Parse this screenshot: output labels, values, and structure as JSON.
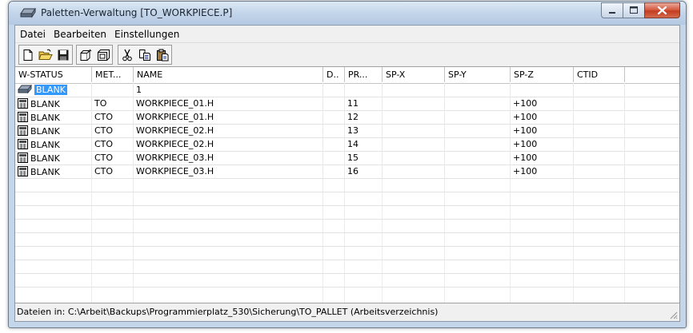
{
  "window": {
    "title": "Paletten-Verwaltung [TO_WORKPIECE.P]",
    "controls": [
      "minimize-icon",
      "maximize-icon",
      "close-icon"
    ],
    "accent_colors": {
      "titlebar": "#c3d5ea",
      "close_button": "#c43c1f",
      "selection": "#3399ff"
    }
  },
  "menu": {
    "file": "Datei",
    "edit": "Bearbeiten",
    "settings": "Einstellungen"
  },
  "toolbar": {
    "buttons": [
      "new-file-icon",
      "open-folder-icon",
      "save-icon",
      "clamp-icon",
      "frame-icon",
      "cut-icon",
      "copy-icon",
      "paste-icon"
    ]
  },
  "table": {
    "columns": [
      "W-STATUS",
      "MET...",
      "NAME",
      "D..",
      "PR...",
      "SP-X",
      "SP-Y",
      "SP-Z",
      "CTID"
    ],
    "rows": [
      {
        "status": "BLANK",
        "method": "",
        "name": "1",
        "d": "",
        "pr": "",
        "spx": "",
        "spy": "",
        "spz": "",
        "ctid": "",
        "icon": "pallet-icon",
        "selected": true
      },
      {
        "status": "BLANK",
        "method": "TO",
        "name": "WORKPIECE_01.H",
        "d": "",
        "pr": "11",
        "spx": "",
        "spy": "",
        "spz": "+100",
        "ctid": "",
        "icon": "workpiece-icon"
      },
      {
        "status": "BLANK",
        "method": "CTO",
        "name": "WORKPIECE_01.H",
        "d": "",
        "pr": "12",
        "spx": "",
        "spy": "",
        "spz": "+100",
        "ctid": "",
        "icon": "workpiece-icon"
      },
      {
        "status": "BLANK",
        "method": "CTO",
        "name": "WORKPIECE_02.H",
        "d": "",
        "pr": "13",
        "spx": "",
        "spy": "",
        "spz": "+100",
        "ctid": "",
        "icon": "workpiece-icon"
      },
      {
        "status": "BLANK",
        "method": "CTO",
        "name": "WORKPIECE_02.H",
        "d": "",
        "pr": "14",
        "spx": "",
        "spy": "",
        "spz": "+100",
        "ctid": "",
        "icon": "workpiece-icon"
      },
      {
        "status": "BLANK",
        "method": "CTO",
        "name": "WORKPIECE_03.H",
        "d": "",
        "pr": "15",
        "spx": "",
        "spy": "",
        "spz": "+100",
        "ctid": "",
        "icon": "workpiece-icon"
      },
      {
        "status": "BLANK",
        "method": "CTO",
        "name": "WORKPIECE_03.H",
        "d": "",
        "pr": "16",
        "spx": "",
        "spy": "",
        "spz": "+100",
        "ctid": "",
        "icon": "workpiece-icon"
      }
    ]
  },
  "status": "Dateien in: C:\\Arbeit\\Backups\\Programmierplatz_530\\Sicherung\\TO_PALLET (Arbeitsverzeichnis)"
}
